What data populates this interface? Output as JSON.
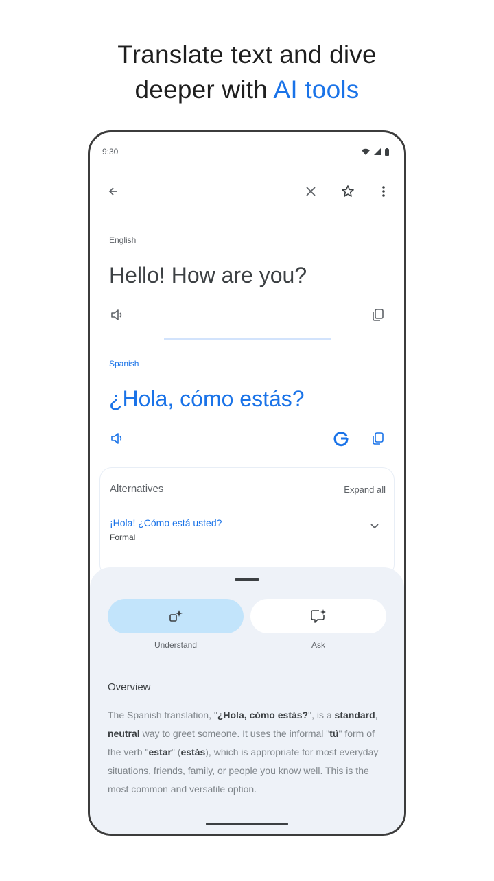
{
  "headline": {
    "line1": "Translate text and dive",
    "line2_prefix": "deeper with ",
    "line2_accent": "AI tools"
  },
  "status_bar": {
    "time": "9:30"
  },
  "source": {
    "language": "English",
    "text": "Hello! How are you?"
  },
  "target": {
    "language": "Spanish",
    "text": "¿Hola, cómo estás?"
  },
  "alternatives": {
    "title": "Alternatives",
    "expand_label": "Expand all",
    "items": [
      {
        "text": "¡Hola! ¿Cómo está usted?",
        "register": "Formal"
      }
    ]
  },
  "sheet": {
    "tabs": [
      {
        "label": "Understand",
        "selected": true
      },
      {
        "label": "Ask",
        "selected": false
      }
    ],
    "overview_title": "Overview",
    "overview": {
      "p1": "The Spanish translation, \"",
      "b1": "¿Hola, cómo estás?",
      "p2": "\", is a ",
      "b2": "standard",
      "p3": ", ",
      "b3": "neutral",
      "p4": " way to greet someone. It uses the informal \"",
      "b4": "tú",
      "p5": "\" form of the verb \"",
      "b5": "estar",
      "p6": "\" (",
      "b6": "estás",
      "p7": "), which is appropriate for most everyday situations, friends, family, or people you know well. This is the most common and versatile option."
    }
  },
  "colors": {
    "accent": "#1a73e8",
    "selected_tab": "#c2e4fb",
    "sheet_bg": "#eef2f8"
  },
  "icons": [
    "back-arrow-icon",
    "close-icon",
    "star-icon",
    "more-vert-icon",
    "speaker-icon",
    "copy-icon",
    "google-icon",
    "sparkle-icon",
    "chat-edit-icon",
    "chevron-down-icon",
    "wifi-icon",
    "signal-icon",
    "battery-icon"
  ]
}
